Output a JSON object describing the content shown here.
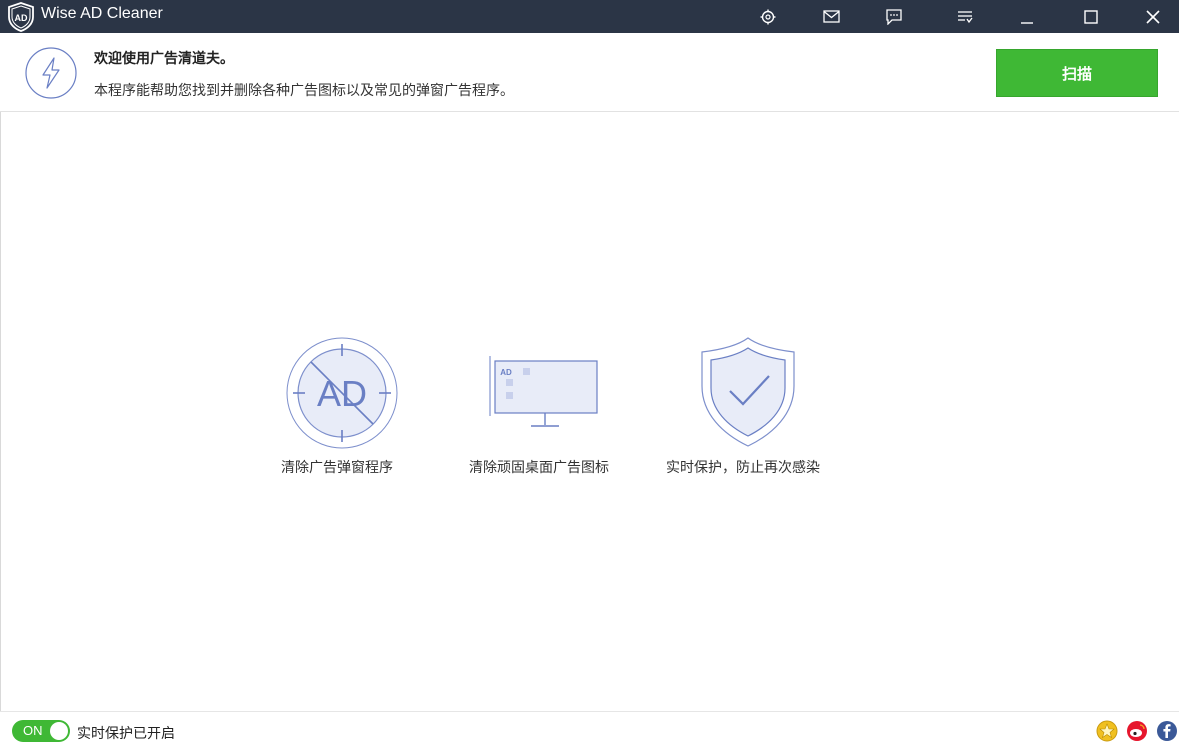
{
  "window": {
    "title": "Wise AD Cleaner",
    "titlebar_color": "#2b3546",
    "toolbar_icons": [
      "skin-icon",
      "mail-icon",
      "feedback-icon",
      "menu-icon"
    ],
    "controls": [
      "minimize-icon",
      "maximize-icon",
      "close-icon"
    ]
  },
  "header": {
    "icon": "lightning-icon",
    "title": "欢迎使用广告清道夫。",
    "description": "本程序能帮助您找到并删除各种广告图标以及常见的弹窗广告程序。",
    "scan_label": "扫描",
    "scan_color": "#3fb835"
  },
  "features": [
    {
      "icon": "ad-remove-icon",
      "ad_text": "AD",
      "label": "清除广告弹窗程序"
    },
    {
      "icon": "desktop-icon",
      "ad_text": "AD",
      "label": "清除顽固桌面广告图标"
    },
    {
      "icon": "shield-check-icon",
      "label": "实时保护，防止再次感染"
    }
  ],
  "status": {
    "toggle_label": "ON",
    "toggle_color": "#3fb835",
    "text": "实时保护已开启"
  },
  "social": [
    "rate-icon",
    "weibo-icon",
    "facebook-icon"
  ],
  "accent_color": "#6a7fc4"
}
